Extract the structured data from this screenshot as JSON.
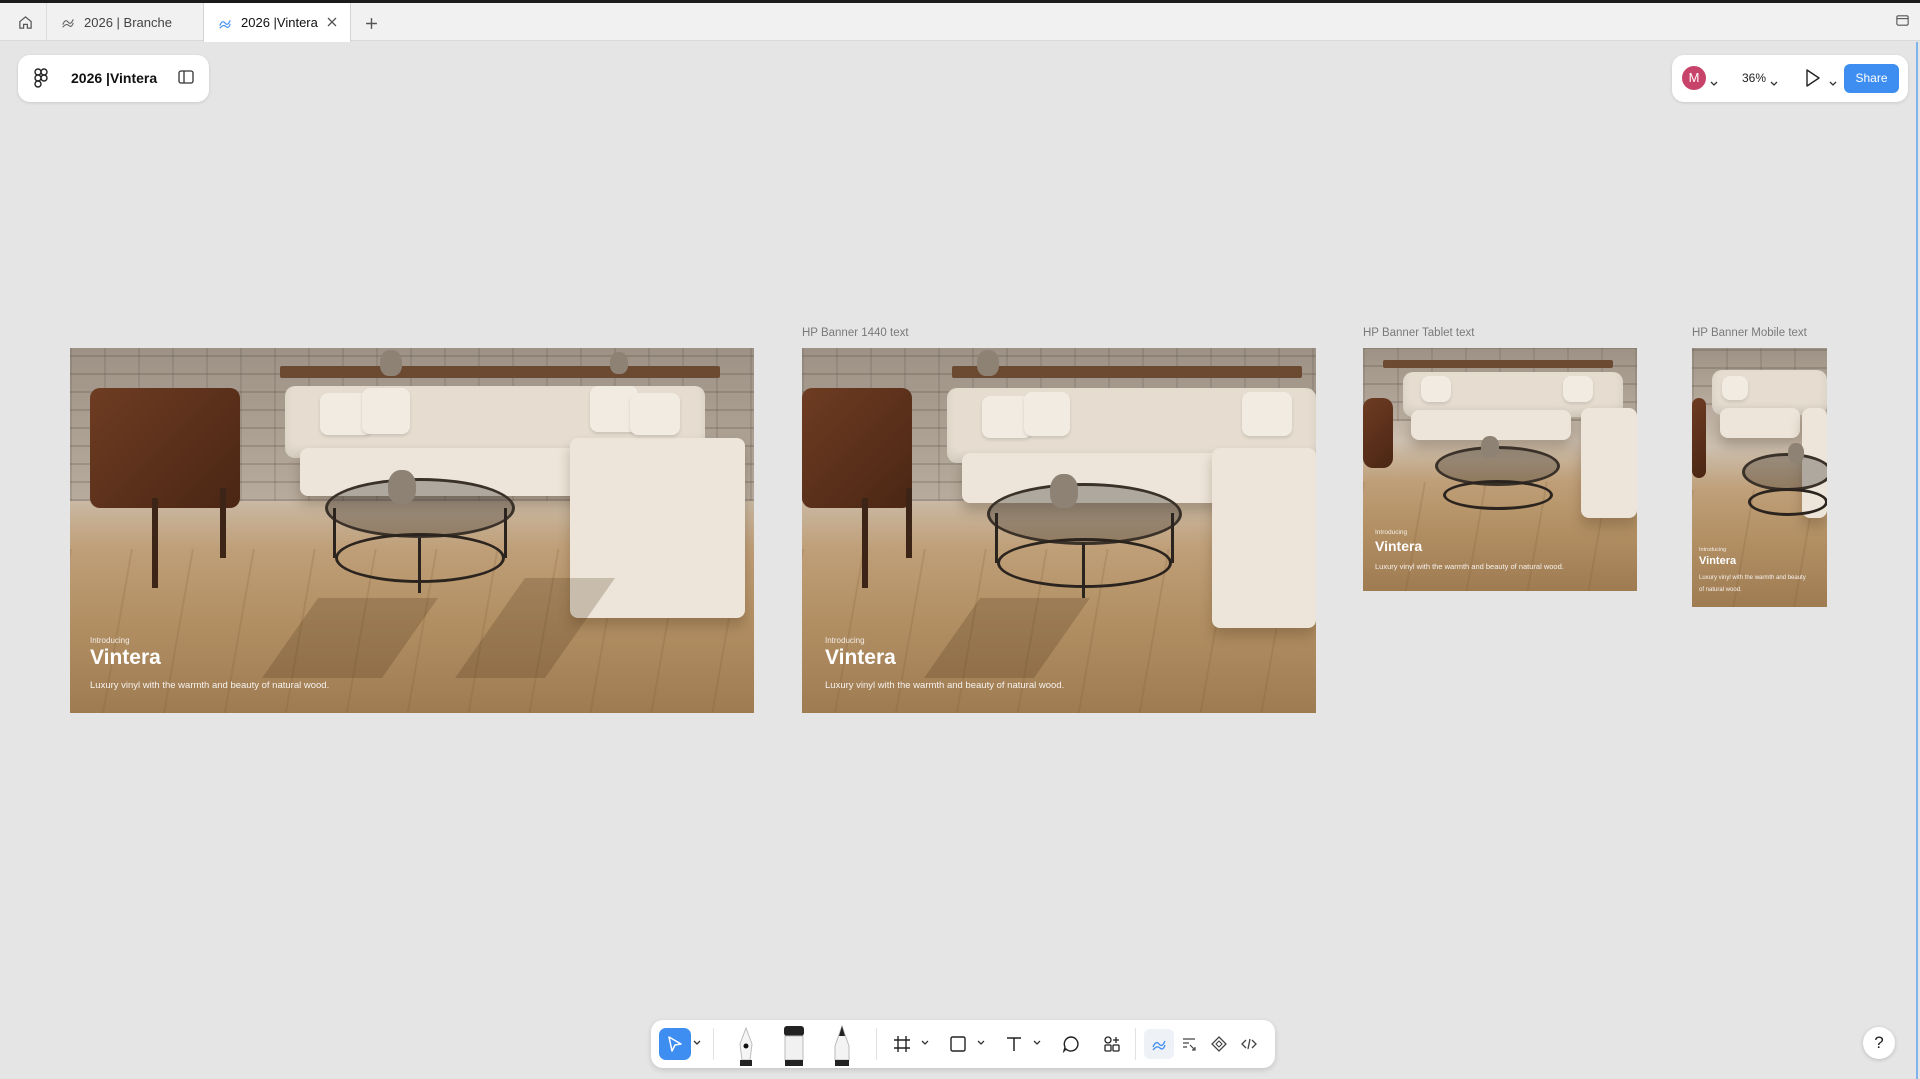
{
  "tabs": [
    {
      "label": "2026 | Branche"
    },
    {
      "label": "2026 |Vintera"
    }
  ],
  "file": {
    "title": "2026 |Vintera"
  },
  "header": {
    "avatar_initial": "M",
    "zoom": "36%",
    "share_label": "Share"
  },
  "frames": [
    {
      "label": "",
      "intro": "Introducing",
      "title": "Vintera",
      "description": "Luxury vinyl with the warmth and beauty of natural wood."
    },
    {
      "label": "HP Banner 1440 text",
      "intro": "Introducing",
      "title": "Vintera",
      "description": "Luxury vinyl with the warmth and beauty of natural wood."
    },
    {
      "label": "HP Banner Tablet text",
      "intro": "Introducing",
      "title": "Vintera",
      "description": "Luxury vinyl with the warmth and beauty of natural wood."
    },
    {
      "label": "HP Banner Mobile text",
      "intro": "Introducing",
      "title": "Vintera",
      "description": "Luxury vinyl with the warmth and beauty of natural wood."
    }
  ],
  "toolbar": {
    "tools": [
      "move-tool",
      "pen-tool",
      "marker-tool",
      "pencil-tool",
      "frame-tool",
      "shape-tool",
      "text-tool",
      "comment-tool",
      "actions-tool",
      "draw-mode",
      "dev-annotations",
      "components",
      "dev-mode"
    ]
  },
  "help": {
    "label": "?"
  },
  "colors": {
    "accent": "#3d8ef0",
    "avatar": "#c8436a",
    "canvas": "#e5e5e5"
  }
}
